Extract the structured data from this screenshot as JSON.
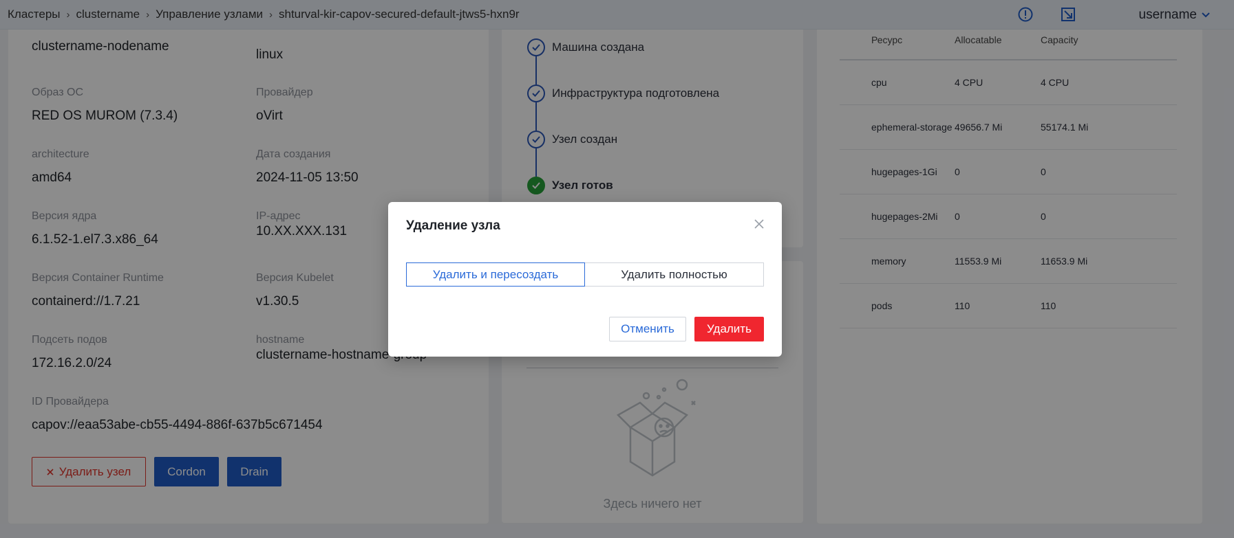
{
  "header": {
    "breadcrumb": [
      "Кластеры",
      "clustername",
      "Управление узлами",
      "shturval-kir-capov-secured-default-jtws5-hxn9r"
    ],
    "username": "username"
  },
  "node_info": {
    "name_value": "clustername-nodename",
    "os_value": "linux",
    "os_image": {
      "label": "Образ ОС",
      "value": "RED OS MUROM (7.3.4)"
    },
    "provider": {
      "label": "Провайдер",
      "value": "oVirt"
    },
    "architecture": {
      "label": "architecture",
      "value": "amd64"
    },
    "created": {
      "label": "Дата создания",
      "value": "2024-11-05 13:50"
    },
    "kernel": {
      "label": "Версия ядра",
      "value": "6.1.52-1.el7.3.x86_64"
    },
    "ip": {
      "label": "IP-адрес",
      "value": "10.XX.XXX.131"
    },
    "runtime": {
      "label": "Версия Container Runtime",
      "value": "containerd://1.7.21"
    },
    "kubelet": {
      "label": "Версия Kubelet",
      "value": "v1.30.5"
    },
    "pod_cidr": {
      "label": "Подсеть подов",
      "value": "172.16.2.0/24"
    },
    "hostname": {
      "label": "hostname",
      "value": "clustername-hostname-group"
    },
    "provider_id": {
      "label": "ID Провайдера",
      "value": "capov://eaa53abe-cb55-4494-886f-637b5c671454"
    }
  },
  "actions": {
    "delete": "Удалить узел",
    "cordon": "Cordon",
    "drain": "Drain"
  },
  "timeline": [
    {
      "label": "Машина создана",
      "done": false
    },
    {
      "label": "Инфраструктура подготовлена",
      "done": false
    },
    {
      "label": "Узел создан",
      "done": false
    },
    {
      "label": "Узел готов",
      "done": true
    }
  ],
  "empty_state": {
    "text": "Здесь ничего нет"
  },
  "resources": {
    "headers": [
      "Ресурс",
      "Allocatable",
      "Capacity"
    ],
    "rows": [
      [
        "cpu",
        "4 CPU",
        "4 CPU"
      ],
      [
        "ephemeral-storage",
        "49656.7 Mi",
        "55174.1 Mi"
      ],
      [
        "hugepages-1Gi",
        "0",
        "0"
      ],
      [
        "hugepages-2Mi",
        "0",
        "0"
      ],
      [
        "memory",
        "11553.9 Mi",
        "11653.9 Mi"
      ],
      [
        "pods",
        "110",
        "110"
      ]
    ]
  },
  "modal": {
    "title": "Удаление узла",
    "option_recreate": "Удалить и пересоздать",
    "option_full": "Удалить полностью",
    "cancel": "Отменить",
    "confirm": "Удалить"
  },
  "colors": {
    "primary": "#1f5cc7",
    "danger": "#f0262f",
    "success": "#27a03a"
  }
}
